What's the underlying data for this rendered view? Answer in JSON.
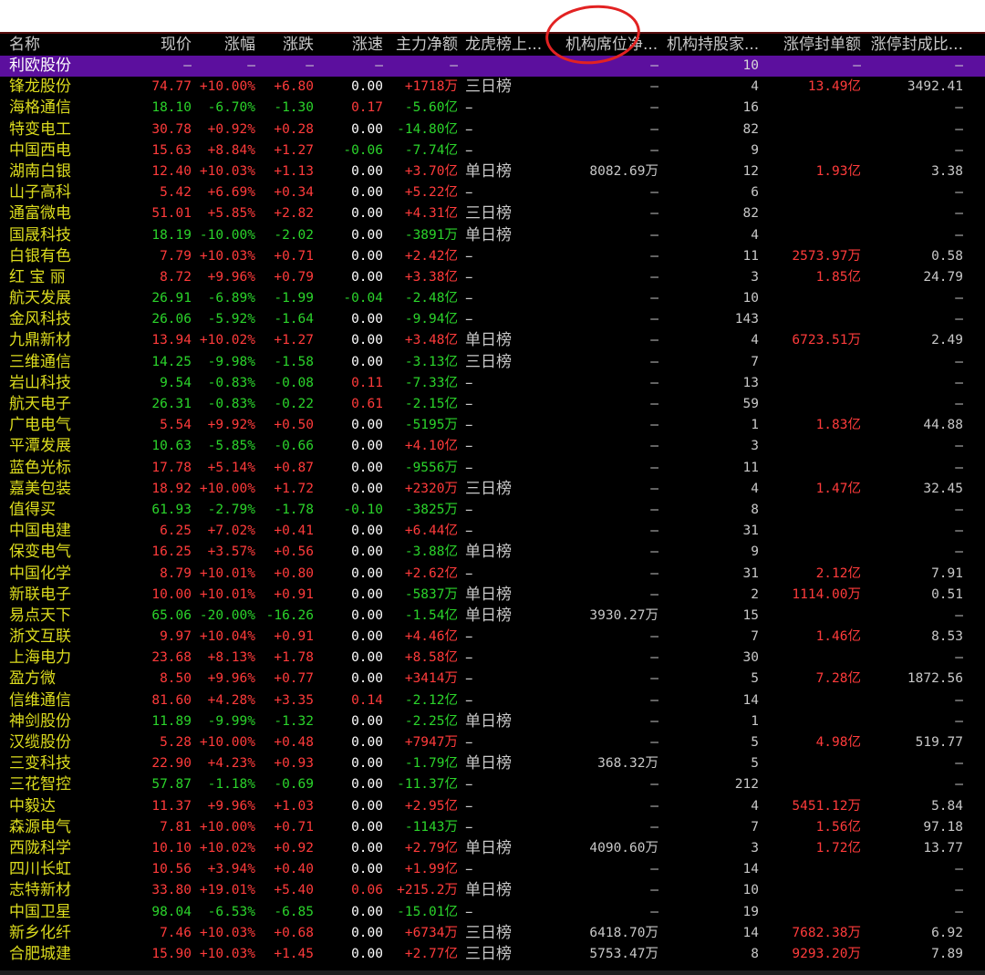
{
  "colors": {
    "up": "#ff3b3b",
    "down": "#2bd42b",
    "selected_row": "#5c0f9e",
    "name": "#dcdc1e"
  },
  "columns": [
    "名称",
    "现价",
    "涨幅",
    "涨跌",
    "涨速",
    "主力净额",
    "龙虎榜上...",
    "机构席位净...",
    "机构持股家...",
    "涨停封单额",
    "涨停封成比..."
  ],
  "rows": [
    {
      "name": "利欧股份",
      "price": "–",
      "pct": "–",
      "chg": "–",
      "spd": "–",
      "flow": "–",
      "lhb": "",
      "seat": "–",
      "hold": "10",
      "seal": "–",
      "ratio": "–",
      "dir": "flat",
      "spd_dir": "flat",
      "flow_dir": "flat",
      "selected": true
    },
    {
      "name": "锋龙股份",
      "price": "74.77",
      "pct": "+10.00%",
      "chg": "+6.80",
      "spd": "0.00",
      "flow": "+1718万",
      "lhb": "三日榜",
      "seat": "–",
      "hold": "4",
      "seal": "13.49亿",
      "ratio": "3492.41",
      "dir": "up",
      "spd_dir": "flat",
      "flow_dir": "up"
    },
    {
      "name": "海格通信",
      "price": "18.10",
      "pct": "-6.70%",
      "chg": "-1.30",
      "spd": "0.17",
      "flow": "-5.60亿",
      "lhb": "–",
      "seat": "–",
      "hold": "16",
      "seal": "–",
      "ratio": "–",
      "dir": "down",
      "spd_dir": "up",
      "flow_dir": "down"
    },
    {
      "name": "特变电工",
      "price": "30.78",
      "pct": "+0.92%",
      "chg": "+0.28",
      "spd": "0.00",
      "flow": "-14.80亿",
      "lhb": "–",
      "seat": "–",
      "hold": "82",
      "seal": "–",
      "ratio": "–",
      "dir": "up",
      "spd_dir": "flat",
      "flow_dir": "down"
    },
    {
      "name": "中国西电",
      "price": "15.63",
      "pct": "+8.84%",
      "chg": "+1.27",
      "spd": "-0.06",
      "flow": "-7.74亿",
      "lhb": "–",
      "seat": "–",
      "hold": "9",
      "seal": "–",
      "ratio": "–",
      "dir": "up",
      "spd_dir": "down",
      "flow_dir": "down"
    },
    {
      "name": "湖南白银",
      "price": "12.40",
      "pct": "+10.03%",
      "chg": "+1.13",
      "spd": "0.00",
      "flow": "+3.70亿",
      "lhb": "单日榜",
      "seat": "8082.69万",
      "hold": "12",
      "seal": "1.93亿",
      "ratio": "3.38",
      "dir": "up",
      "spd_dir": "flat",
      "flow_dir": "up"
    },
    {
      "name": "山子高科",
      "price": "5.42",
      "pct": "+6.69%",
      "chg": "+0.34",
      "spd": "0.00",
      "flow": "+5.22亿",
      "lhb": "–",
      "seat": "–",
      "hold": "6",
      "seal": "–",
      "ratio": "–",
      "dir": "up",
      "spd_dir": "flat",
      "flow_dir": "up"
    },
    {
      "name": "通富微电",
      "price": "51.01",
      "pct": "+5.85%",
      "chg": "+2.82",
      "spd": "0.00",
      "flow": "+4.31亿",
      "lhb": "三日榜",
      "seat": "–",
      "hold": "82",
      "seal": "–",
      "ratio": "–",
      "dir": "up",
      "spd_dir": "flat",
      "flow_dir": "up"
    },
    {
      "name": "国晟科技",
      "price": "18.19",
      "pct": "-10.00%",
      "chg": "-2.02",
      "spd": "0.00",
      "flow": "-3891万",
      "lhb": "单日榜",
      "seat": "–",
      "hold": "4",
      "seal": "–",
      "ratio": "–",
      "dir": "down",
      "spd_dir": "flat",
      "flow_dir": "down"
    },
    {
      "name": "白银有色",
      "price": "7.79",
      "pct": "+10.03%",
      "chg": "+0.71",
      "spd": "0.00",
      "flow": "+2.42亿",
      "lhb": "–",
      "seat": "–",
      "hold": "11",
      "seal": "2573.97万",
      "ratio": "0.58",
      "dir": "up",
      "spd_dir": "flat",
      "flow_dir": "up"
    },
    {
      "name": "红 宝 丽",
      "price": "8.72",
      "pct": "+9.96%",
      "chg": "+0.79",
      "spd": "0.00",
      "flow": "+3.38亿",
      "lhb": "–",
      "seat": "–",
      "hold": "3",
      "seal": "1.85亿",
      "ratio": "24.79",
      "dir": "up",
      "spd_dir": "flat",
      "flow_dir": "up"
    },
    {
      "name": "航天发展",
      "price": "26.91",
      "pct": "-6.89%",
      "chg": "-1.99",
      "spd": "-0.04",
      "flow": "-2.48亿",
      "lhb": "–",
      "seat": "–",
      "hold": "10",
      "seal": "–",
      "ratio": "–",
      "dir": "down",
      "spd_dir": "down",
      "flow_dir": "down"
    },
    {
      "name": "金风科技",
      "price": "26.06",
      "pct": "-5.92%",
      "chg": "-1.64",
      "spd": "0.00",
      "flow": "-9.94亿",
      "lhb": "–",
      "seat": "–",
      "hold": "143",
      "seal": "–",
      "ratio": "–",
      "dir": "down",
      "spd_dir": "flat",
      "flow_dir": "down"
    },
    {
      "name": "九鼎新材",
      "price": "13.94",
      "pct": "+10.02%",
      "chg": "+1.27",
      "spd": "0.00",
      "flow": "+3.48亿",
      "lhb": "单日榜",
      "seat": "–",
      "hold": "4",
      "seal": "6723.51万",
      "ratio": "2.49",
      "dir": "up",
      "spd_dir": "flat",
      "flow_dir": "up"
    },
    {
      "name": "三维通信",
      "price": "14.25",
      "pct": "-9.98%",
      "chg": "-1.58",
      "spd": "0.00",
      "flow": "-3.13亿",
      "lhb": "三日榜",
      "seat": "–",
      "hold": "7",
      "seal": "–",
      "ratio": "–",
      "dir": "down",
      "spd_dir": "flat",
      "flow_dir": "down"
    },
    {
      "name": "岩山科技",
      "price": "9.54",
      "pct": "-0.83%",
      "chg": "-0.08",
      "spd": "0.11",
      "flow": "-7.33亿",
      "lhb": "–",
      "seat": "–",
      "hold": "13",
      "seal": "–",
      "ratio": "–",
      "dir": "down",
      "spd_dir": "up",
      "flow_dir": "down"
    },
    {
      "name": "航天电子",
      "price": "26.31",
      "pct": "-0.83%",
      "chg": "-0.22",
      "spd": "0.61",
      "flow": "-2.15亿",
      "lhb": "–",
      "seat": "–",
      "hold": "59",
      "seal": "–",
      "ratio": "–",
      "dir": "down",
      "spd_dir": "up",
      "flow_dir": "down"
    },
    {
      "name": "广电电气",
      "price": "5.54",
      "pct": "+9.92%",
      "chg": "+0.50",
      "spd": "0.00",
      "flow": "-5195万",
      "lhb": "–",
      "seat": "–",
      "hold": "1",
      "seal": "1.83亿",
      "ratio": "44.88",
      "dir": "up",
      "spd_dir": "flat",
      "flow_dir": "down"
    },
    {
      "name": "平潭发展",
      "price": "10.63",
      "pct": "-5.85%",
      "chg": "-0.66",
      "spd": "0.00",
      "flow": "+4.10亿",
      "lhb": "–",
      "seat": "–",
      "hold": "3",
      "seal": "–",
      "ratio": "–",
      "dir": "down",
      "spd_dir": "flat",
      "flow_dir": "up"
    },
    {
      "name": "蓝色光标",
      "price": "17.78",
      "pct": "+5.14%",
      "chg": "+0.87",
      "spd": "0.00",
      "flow": "-9556万",
      "lhb": "–",
      "seat": "–",
      "hold": "11",
      "seal": "–",
      "ratio": "–",
      "dir": "up",
      "spd_dir": "flat",
      "flow_dir": "down"
    },
    {
      "name": "嘉美包装",
      "price": "18.92",
      "pct": "+10.00%",
      "chg": "+1.72",
      "spd": "0.00",
      "flow": "+2320万",
      "lhb": "三日榜",
      "seat": "–",
      "hold": "4",
      "seal": "1.47亿",
      "ratio": "32.45",
      "dir": "up",
      "spd_dir": "flat",
      "flow_dir": "up"
    },
    {
      "name": "值得买",
      "price": "61.93",
      "pct": "-2.79%",
      "chg": "-1.78",
      "spd": "-0.10",
      "flow": "-3825万",
      "lhb": "–",
      "seat": "–",
      "hold": "8",
      "seal": "–",
      "ratio": "–",
      "dir": "down",
      "spd_dir": "down",
      "flow_dir": "down"
    },
    {
      "name": "中国电建",
      "price": "6.25",
      "pct": "+7.02%",
      "chg": "+0.41",
      "spd": "0.00",
      "flow": "+6.44亿",
      "lhb": "–",
      "seat": "–",
      "hold": "31",
      "seal": "–",
      "ratio": "–",
      "dir": "up",
      "spd_dir": "flat",
      "flow_dir": "up"
    },
    {
      "name": "保变电气",
      "price": "16.25",
      "pct": "+3.57%",
      "chg": "+0.56",
      "spd": "0.00",
      "flow": "-3.88亿",
      "lhb": "单日榜",
      "seat": "–",
      "hold": "9",
      "seal": "–",
      "ratio": "–",
      "dir": "up",
      "spd_dir": "flat",
      "flow_dir": "down"
    },
    {
      "name": "中国化学",
      "price": "8.79",
      "pct": "+10.01%",
      "chg": "+0.80",
      "spd": "0.00",
      "flow": "+2.62亿",
      "lhb": "–",
      "seat": "–",
      "hold": "31",
      "seal": "2.12亿",
      "ratio": "7.91",
      "dir": "up",
      "spd_dir": "flat",
      "flow_dir": "up"
    },
    {
      "name": "新联电子",
      "price": "10.00",
      "pct": "+10.01%",
      "chg": "+0.91",
      "spd": "0.00",
      "flow": "-5837万",
      "lhb": "单日榜",
      "seat": "–",
      "hold": "2",
      "seal": "1114.00万",
      "ratio": "0.51",
      "dir": "up",
      "spd_dir": "flat",
      "flow_dir": "down"
    },
    {
      "name": "易点天下",
      "price": "65.06",
      "pct": "-20.00%",
      "chg": "-16.26",
      "spd": "0.00",
      "flow": "-1.54亿",
      "lhb": "单日榜",
      "seat": "3930.27万",
      "hold": "15",
      "seal": "–",
      "ratio": "–",
      "dir": "down",
      "spd_dir": "flat",
      "flow_dir": "down"
    },
    {
      "name": "浙文互联",
      "price": "9.97",
      "pct": "+10.04%",
      "chg": "+0.91",
      "spd": "0.00",
      "flow": "+4.46亿",
      "lhb": "–",
      "seat": "–",
      "hold": "7",
      "seal": "1.46亿",
      "ratio": "8.53",
      "dir": "up",
      "spd_dir": "flat",
      "flow_dir": "up"
    },
    {
      "name": "上海电力",
      "price": "23.68",
      "pct": "+8.13%",
      "chg": "+1.78",
      "spd": "0.00",
      "flow": "+8.58亿",
      "lhb": "–",
      "seat": "–",
      "hold": "30",
      "seal": "–",
      "ratio": "–",
      "dir": "up",
      "spd_dir": "flat",
      "flow_dir": "up"
    },
    {
      "name": "盈方微",
      "price": "8.50",
      "pct": "+9.96%",
      "chg": "+0.77",
      "spd": "0.00",
      "flow": "+3414万",
      "lhb": "–",
      "seat": "–",
      "hold": "5",
      "seal": "7.28亿",
      "ratio": "1872.56",
      "dir": "up",
      "spd_dir": "flat",
      "flow_dir": "up"
    },
    {
      "name": "信维通信",
      "price": "81.60",
      "pct": "+4.28%",
      "chg": "+3.35",
      "spd": "0.14",
      "flow": "-2.12亿",
      "lhb": "–",
      "seat": "–",
      "hold": "14",
      "seal": "–",
      "ratio": "–",
      "dir": "up",
      "spd_dir": "up",
      "flow_dir": "down"
    },
    {
      "name": "神剑股份",
      "price": "11.89",
      "pct": "-9.99%",
      "chg": "-1.32",
      "spd": "0.00",
      "flow": "-2.25亿",
      "lhb": "单日榜",
      "seat": "–",
      "hold": "1",
      "seal": "–",
      "ratio": "–",
      "dir": "down",
      "spd_dir": "flat",
      "flow_dir": "down"
    },
    {
      "name": "汉缆股份",
      "price": "5.28",
      "pct": "+10.00%",
      "chg": "+0.48",
      "spd": "0.00",
      "flow": "+7947万",
      "lhb": "–",
      "seat": "–",
      "hold": "5",
      "seal": "4.98亿",
      "ratio": "519.77",
      "dir": "up",
      "spd_dir": "flat",
      "flow_dir": "up"
    },
    {
      "name": "三变科技",
      "price": "22.90",
      "pct": "+4.23%",
      "chg": "+0.93",
      "spd": "0.00",
      "flow": "-1.79亿",
      "lhb": "单日榜",
      "seat": "368.32万",
      "hold": "5",
      "seal": "–",
      "ratio": "–",
      "dir": "up",
      "spd_dir": "flat",
      "flow_dir": "down"
    },
    {
      "name": "三花智控",
      "price": "57.87",
      "pct": "-1.18%",
      "chg": "-0.69",
      "spd": "0.00",
      "flow": "-11.37亿",
      "lhb": "–",
      "seat": "–",
      "hold": "212",
      "seal": "–",
      "ratio": "–",
      "dir": "down",
      "spd_dir": "flat",
      "flow_dir": "down"
    },
    {
      "name": "中毅达",
      "price": "11.37",
      "pct": "+9.96%",
      "chg": "+1.03",
      "spd": "0.00",
      "flow": "+2.95亿",
      "lhb": "–",
      "seat": "–",
      "hold": "4",
      "seal": "5451.12万",
      "ratio": "5.84",
      "dir": "up",
      "spd_dir": "flat",
      "flow_dir": "up"
    },
    {
      "name": "森源电气",
      "price": "7.81",
      "pct": "+10.00%",
      "chg": "+0.71",
      "spd": "0.00",
      "flow": "-1143万",
      "lhb": "–",
      "seat": "–",
      "hold": "7",
      "seal": "1.56亿",
      "ratio": "97.18",
      "dir": "up",
      "spd_dir": "flat",
      "flow_dir": "down"
    },
    {
      "name": "西陇科学",
      "price": "10.10",
      "pct": "+10.02%",
      "chg": "+0.92",
      "spd": "0.00",
      "flow": "+2.79亿",
      "lhb": "单日榜",
      "seat": "4090.60万",
      "hold": "3",
      "seal": "1.72亿",
      "ratio": "13.77",
      "dir": "up",
      "spd_dir": "flat",
      "flow_dir": "up"
    },
    {
      "name": "四川长虹",
      "price": "10.56",
      "pct": "+3.94%",
      "chg": "+0.40",
      "spd": "0.00",
      "flow": "+1.99亿",
      "lhb": "–",
      "seat": "–",
      "hold": "14",
      "seal": "–",
      "ratio": "–",
      "dir": "up",
      "spd_dir": "flat",
      "flow_dir": "up"
    },
    {
      "name": "志特新材",
      "price": "33.80",
      "pct": "+19.01%",
      "chg": "+5.40",
      "spd": "0.06",
      "flow": "+215.2万",
      "lhb": "单日榜",
      "seat": "–",
      "hold": "10",
      "seal": "–",
      "ratio": "–",
      "dir": "up",
      "spd_dir": "up",
      "flow_dir": "up"
    },
    {
      "name": "中国卫星",
      "price": "98.04",
      "pct": "-6.53%",
      "chg": "-6.85",
      "spd": "0.00",
      "flow": "-15.01亿",
      "lhb": "–",
      "seat": "–",
      "hold": "19",
      "seal": "–",
      "ratio": "–",
      "dir": "down",
      "spd_dir": "flat",
      "flow_dir": "down"
    },
    {
      "name": "新乡化纤",
      "price": "7.46",
      "pct": "+10.03%",
      "chg": "+0.68",
      "spd": "0.00",
      "flow": "+6734万",
      "lhb": "三日榜",
      "seat": "6418.70万",
      "hold": "14",
      "seal": "7682.38万",
      "ratio": "6.92",
      "dir": "up",
      "spd_dir": "flat",
      "flow_dir": "up"
    },
    {
      "name": "合肥城建",
      "price": "15.90",
      "pct": "+10.03%",
      "chg": "+1.45",
      "spd": "0.00",
      "flow": "+2.77亿",
      "lhb": "三日榜",
      "seat": "5753.47万",
      "hold": "8",
      "seal": "9293.20万",
      "ratio": "7.89",
      "dir": "up",
      "spd_dir": "flat",
      "flow_dir": "up"
    }
  ]
}
